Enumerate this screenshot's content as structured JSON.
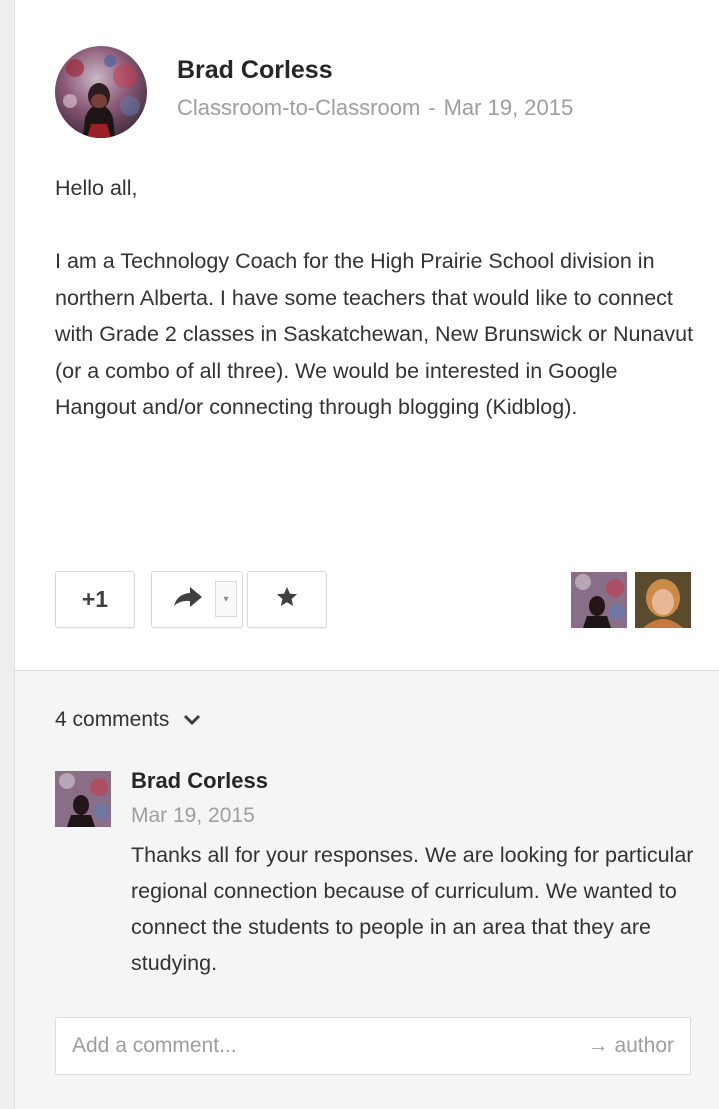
{
  "post": {
    "author": "Brad Corless",
    "community": "Classroom-to-Classroom",
    "separator": "-",
    "date": "Mar 19, 2015",
    "greeting": "Hello all,",
    "body": "I am a Technology Coach for the High Prairie School division in northern Alberta.  I have some teachers that would like to connect with Grade 2 classes in Saskatchewan, New Brunswick or Nunavut (or a combo of all three).  We would be interested in Google Hangout and/or connecting through blogging (Kidblog)."
  },
  "actions": {
    "plus_one_label": "+1",
    "share_icon": "share-arrow-icon",
    "share_dropdown_icon": "caret-down-icon",
    "star_icon": "star-icon"
  },
  "plusers": [
    {
      "name": "brad-corless-avatar"
    },
    {
      "name": "teacher-avatar"
    }
  ],
  "comments": {
    "count_label": "4 comments",
    "toggle_icon": "chevron-down-icon",
    "items": [
      {
        "author": "Brad Corless",
        "date": "Mar 19, 2015",
        "text": "Thanks all for your responses.  We are looking for particular regional connection because of curriculum.  We wanted to connect the students to people in an area that they are studying."
      }
    ],
    "add_placeholder": "Add a comment...",
    "mention_label": "→ author"
  },
  "colors": {
    "panel_bg": "#f5f5f5",
    "meta_text": "#9e9e9e",
    "border": "#dcdcdc"
  }
}
